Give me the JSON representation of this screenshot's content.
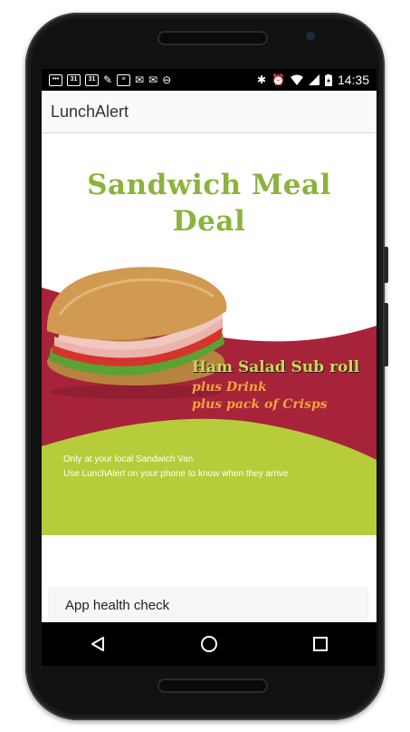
{
  "status_bar": {
    "time": "14:35",
    "left_icons": [
      "more-icon",
      "calendar-icon",
      "calendar-icon",
      "tools-icon",
      "notes-icon",
      "gmail-icon",
      "gmail-icon",
      "sync-icon"
    ],
    "calendar_day": "31",
    "right_icons": [
      "bluetooth-icon",
      "alarm-icon",
      "wifi-icon",
      "signal-icon",
      "battery-charging-icon"
    ]
  },
  "app_bar": {
    "title": "LunchAlert"
  },
  "banner": {
    "headline_line1": "Sandwich Meal",
    "headline_line2": "Deal",
    "main_item": "Ham Salad Sub roll",
    "extra1": "plus Drink",
    "extra2": "plus pack of Crisps",
    "note1": "Only at your local Sandwich Van.",
    "note2": "Use LunchAlert on your phone to know when they arrive",
    "colors": {
      "headline": "#8ab43c",
      "maroon": "#a7233a",
      "green": "#b6cc3a",
      "orange": "#f0a540"
    }
  },
  "health_check": {
    "label": "App health check"
  },
  "nav": {
    "back": "back-icon",
    "home": "home-icon",
    "recents": "recents-icon"
  }
}
